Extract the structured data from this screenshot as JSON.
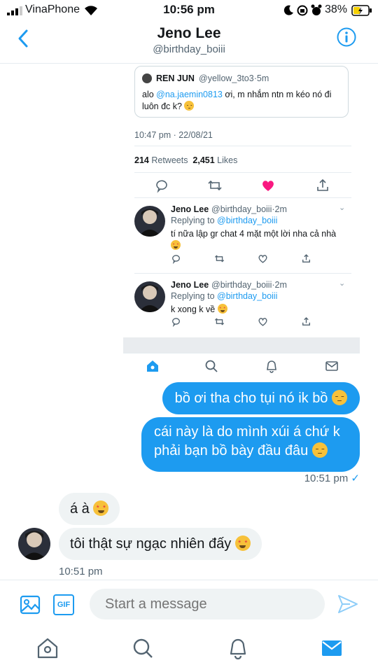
{
  "status_bar": {
    "carrier": "VinaPhone",
    "time": "10:56 pm",
    "battery": "38%"
  },
  "header": {
    "name": "Jeno Lee",
    "handle": "@birthday_boiii"
  },
  "tweet": {
    "quote": {
      "name": "REN JUN",
      "handle": "@yellow_3to3·5m",
      "text_prefix": "alo ",
      "mention": "@na.jaemin0813",
      "text_rest": " ơi, m nhắm ntn m kéo nó đi luôn đc k?"
    },
    "timestamp": "10:47 pm · 22/08/21",
    "retweets_count": "214",
    "retweets_label": "Retweets",
    "likes_count": "2,451",
    "likes_label": "Likes",
    "replies": [
      {
        "name": "Jeno Lee",
        "handle": "@birthday_boiii·2m",
        "replying_label": "Replying to ",
        "replying_to": "@birthday_boiii",
        "text": "tí nữa lập gr chat 4 mặt một lời nha cả nhà"
      },
      {
        "name": "Jeno Lee",
        "handle": "@birthday_boiii·2m",
        "replying_label": "Replying to ",
        "replying_to": "@birthday_boiii",
        "text": "k xong k về"
      }
    ]
  },
  "messages": {
    "outgoing": [
      {
        "text": "bồ ơi tha cho tụi nó ik bồ"
      },
      {
        "line1": "cái này là do mình xúi á chứ k",
        "line2": "phải bạn bồ bày đầu đâu"
      }
    ],
    "outgoing_time": "10:51 pm",
    "outgoing_check": "✓",
    "incoming": [
      {
        "text": "á à"
      },
      {
        "text": "tôi thật sự ngạc nhiên đấy"
      }
    ],
    "incoming_time": "10:51 pm"
  },
  "composer": {
    "placeholder": "Start a message",
    "gif_label": "GIF"
  },
  "colors": {
    "accent": "#1d9bf0",
    "bubble_in": "#eff3f4",
    "text_secondary": "#536471"
  },
  "icons": [
    "back-chevron-icon",
    "info-icon",
    "image-icon",
    "gif-icon",
    "send-icon",
    "home-icon",
    "search-icon",
    "bell-icon",
    "mail-icon",
    "heart-icon",
    "retweet-icon",
    "reply-icon",
    "share-icon"
  ]
}
